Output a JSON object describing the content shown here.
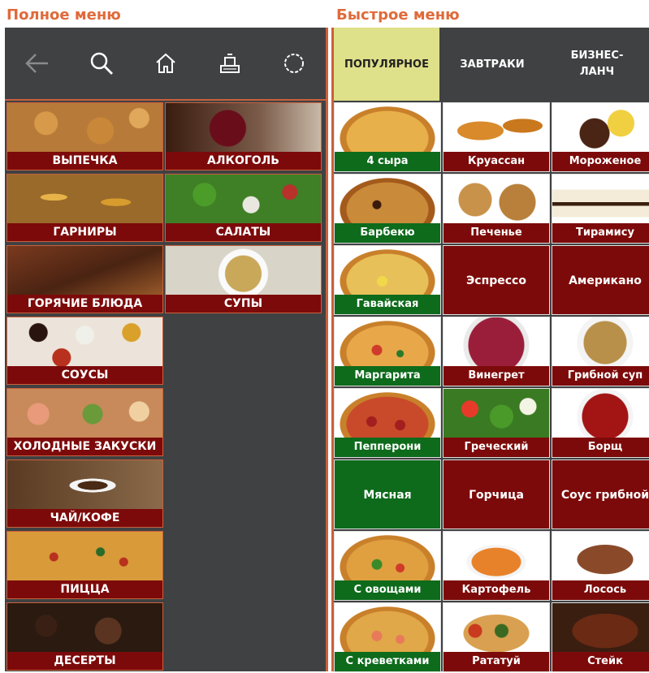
{
  "headings": {
    "full_menu": "Полное меню",
    "quick_menu": "Быстрое меню"
  },
  "colors": {
    "heading": "#e06a3a",
    "panel_bg": "#404142",
    "accent_border": "#c9603c",
    "label_red": "#7d0a0a",
    "label_green": "#0d6b1b",
    "tab_active": "#dfe08a"
  },
  "toolbar": {
    "icons": [
      "back-arrow-icon",
      "search-icon",
      "home-icon",
      "receipt-printer-icon",
      "settings-gear-icon"
    ]
  },
  "categories": [
    {
      "label": "ВЫПЕЧКА",
      "image": "pastry"
    },
    {
      "label": "АЛКОГОЛЬ",
      "image": "wine"
    },
    {
      "label": "ГАРНИРЫ",
      "image": "potato"
    },
    {
      "label": "САЛАТЫ",
      "image": "salad"
    },
    {
      "label": "ГОРЯЧИЕ БЛЮДА",
      "image": "steak"
    },
    {
      "label": "СУПЫ",
      "image": "soup"
    },
    {
      "label": "СОУСЫ",
      "image": "sauces"
    },
    {
      "label": "ХОЛОДНЫЕ ЗАКУСКИ",
      "image": "snacks"
    },
    {
      "label": "ЧАЙ/КОФЕ",
      "image": "coffee"
    },
    {
      "label": "ПИЦЦА",
      "image": "pizza"
    },
    {
      "label": "ДЕСЕРТЫ",
      "image": "dessert"
    }
  ],
  "tabs": [
    {
      "label": "ПОПУЛЯРНОЕ",
      "active": true
    },
    {
      "label": "ЗАВТРАКИ",
      "active": false
    },
    {
      "label": "БИЗНЕС-ЛАНЧ",
      "active": false
    }
  ],
  "items": [
    {
      "label": "4 сыра",
      "color": "green",
      "image": "pz1"
    },
    {
      "label": "Круассан",
      "color": "red",
      "image": "croissant"
    },
    {
      "label": "Мороженое",
      "color": "red",
      "image": "icecream"
    },
    {
      "label": "Барбекю",
      "color": "green",
      "image": "pz2"
    },
    {
      "label": "Печенье",
      "color": "red",
      "image": "cookies"
    },
    {
      "label": "Тирамису",
      "color": "red",
      "image": "tiramisu"
    },
    {
      "label": "Гавайская",
      "color": "green",
      "image": "pz3"
    },
    {
      "label": "Эспрессо",
      "color": "red",
      "image": ""
    },
    {
      "label": "Американо",
      "color": "red",
      "image": ""
    },
    {
      "label": "Маргарита",
      "color": "green",
      "image": "pz4"
    },
    {
      "label": "Винегрет",
      "color": "red",
      "image": "vinegret"
    },
    {
      "label": "Грибной суп",
      "color": "red",
      "image": "mushsoup"
    },
    {
      "label": "Пепперони",
      "color": "green",
      "image": "pz5"
    },
    {
      "label": "Греческий",
      "color": "red",
      "image": "greek"
    },
    {
      "label": "Борщ",
      "color": "red",
      "image": "borsch"
    },
    {
      "label": "Мясная",
      "color": "green",
      "image": ""
    },
    {
      "label": "Горчица",
      "color": "red",
      "image": ""
    },
    {
      "label": "Соус грибной",
      "color": "red",
      "image": ""
    },
    {
      "label": "С овощами",
      "color": "green",
      "image": "pz6"
    },
    {
      "label": "Картофель",
      "color": "red",
      "image": "potatoes"
    },
    {
      "label": "Лосось",
      "color": "red",
      "image": "salmon"
    },
    {
      "label": "С креветками",
      "color": "green",
      "image": "pz7"
    },
    {
      "label": "Рататуй",
      "color": "red",
      "image": "ratatouille"
    },
    {
      "label": "Стейк",
      "color": "red",
      "image": "steak2"
    }
  ]
}
